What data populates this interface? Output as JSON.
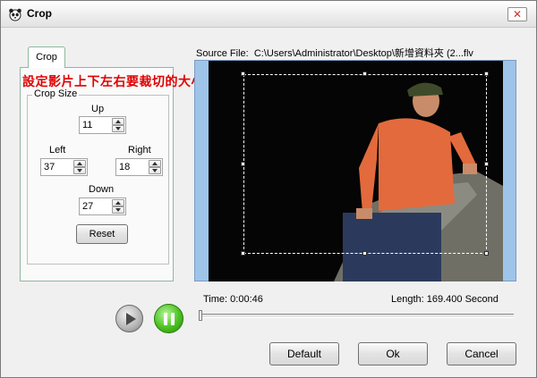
{
  "window": {
    "title": "Crop",
    "icon": "panda-icon",
    "close_glyph": "✕"
  },
  "tab": {
    "label": "Crop"
  },
  "annotation": "設定影片上下左右要裁切的大小",
  "crop_size": {
    "title": "Crop Size",
    "up": {
      "label": "Up",
      "value": "11"
    },
    "left": {
      "label": "Left",
      "value": "37"
    },
    "right": {
      "label": "Right",
      "value": "18"
    },
    "down": {
      "label": "Down",
      "value": "27"
    },
    "reset_label": "Reset"
  },
  "source_file": {
    "label": "Source File:",
    "path": "C:\\Users\\Administrator\\Desktop\\新增資料夾 (2...flv"
  },
  "playback": {
    "time_label": "Time:",
    "time_value": "0:00:46",
    "length_label": "Length:",
    "length_value": "169.400 Second",
    "progress": 0.0
  },
  "buttons": {
    "default_label": "Default",
    "ok_label": "Ok",
    "cancel_label": "Cancel"
  },
  "colors": {
    "video_background": "#050505",
    "frame_border": "#9fc4ea",
    "annotation": "#e00000",
    "pause_button": "#49c21f"
  }
}
